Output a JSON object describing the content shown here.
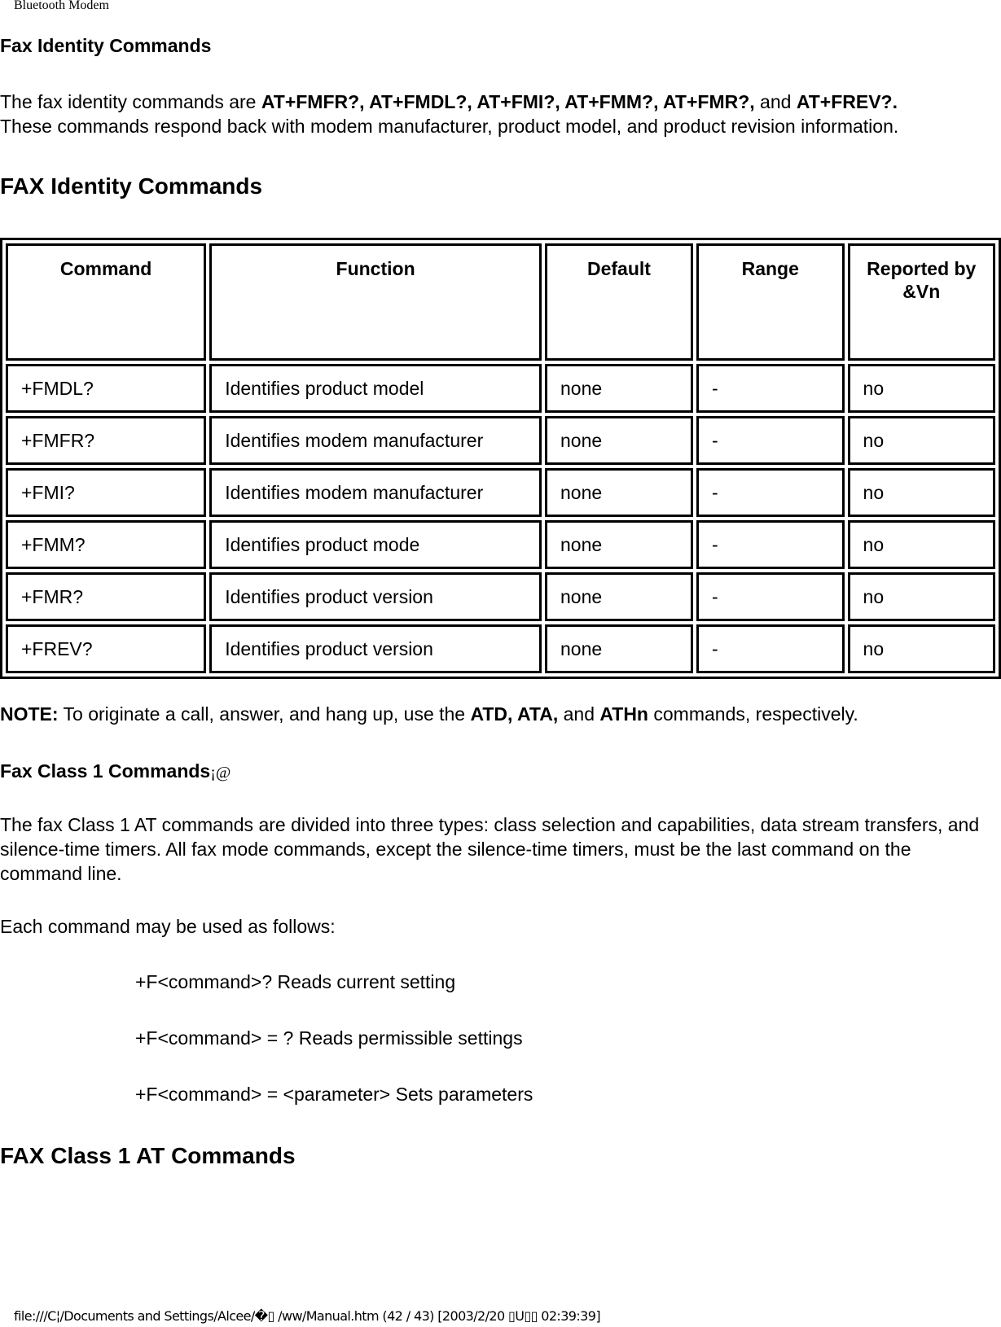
{
  "header": {
    "running_title": "Bluetooth Modem"
  },
  "section1": {
    "heading": "Fax Identity Commands",
    "intro": {
      "prefix": "The fax identity commands are ",
      "commands_bold": "AT+FMFR?, AT+FMDL?, AT+FMI?, AT+FMM?, AT+FMR?,",
      "and": " and ",
      "last_bold": "AT+FREV?.",
      "line2": "These commands respond back with modem manufacturer, product model, and product revision information."
    },
    "table_title": "FAX Identity Commands",
    "table": {
      "headers": [
        "Command",
        "Function",
        "Default",
        "Range",
        "Reported by &Vn"
      ],
      "rows": [
        [
          "+FMDL?",
          "Identifies product model",
          "none",
          "-",
          "no"
        ],
        [
          "+FMFR?",
          "Identifies modem manufacturer",
          "none",
          "-",
          "no"
        ],
        [
          "+FMI?",
          "Identifies modem manufacturer",
          "none",
          "-",
          "no"
        ],
        [
          "+FMM?",
          "Identifies product mode",
          "none",
          "-",
          "no"
        ],
        [
          "+FMR?",
          "Identifies product version",
          "none",
          "-",
          "no"
        ],
        [
          "+FREV?",
          "Identifies product version",
          "none",
          "-",
          "no"
        ]
      ]
    },
    "note": {
      "label": "NOTE:",
      "text1": " To originate a call, answer, and hang up, use the ",
      "bold_cmds": "ATD, ATA,",
      "and": " and ",
      "bold_last": "ATHn",
      "text2": " commands, respectively."
    }
  },
  "section2": {
    "heading": "Fax Class 1 Commands",
    "heading_suffix": "¡@",
    "paragraph": "The fax Class 1 AT commands are divided into three types: class selection and capabilities, data stream transfers, and silence-time timers. All fax mode commands, except the silence-time timers, must be the last command on the command line.",
    "usage_intro": "Each command may be used as follows:",
    "usage": [
      "+F<command>? Reads current setting",
      "+F<command> = ? Reads permissible settings",
      "+F<command> = <parameter> Sets parameters"
    ],
    "table_title": "FAX Class 1 AT Commands"
  },
  "footer": {
    "path": "file:///C¦/Documents and Settings/Alcee/�▯ /ww/Manual.htm (42 / 43) [2003/2/20 ▯U▯▯ 02:39:39]"
  }
}
